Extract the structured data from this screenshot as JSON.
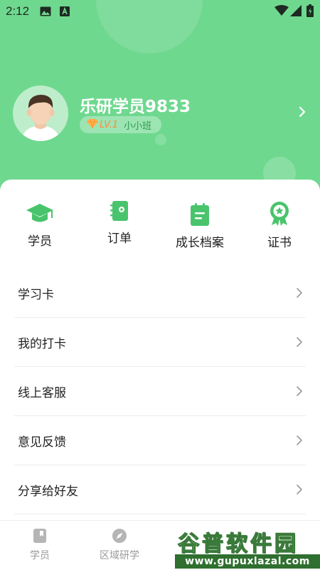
{
  "status_bar": {
    "time": "2:12",
    "icons": [
      "image-icon",
      "a-notification-icon",
      "wifi-icon",
      "signal-icon",
      "battery-icon"
    ]
  },
  "profile": {
    "username": "乐研学员9833",
    "level": "LV.1",
    "class_name": "小小班",
    "icons": [
      "avatar",
      "diamond-icon",
      "chevron-right-icon"
    ]
  },
  "quick_actions": [
    {
      "label": "学员",
      "icon": "graduation-cap-icon"
    },
    {
      "label": "订单",
      "icon": "order-book-icon"
    },
    {
      "label": "成长档案",
      "icon": "growth-file-icon"
    },
    {
      "label": "证书",
      "icon": "certificate-badge-icon"
    }
  ],
  "menu": [
    {
      "label": "学习卡"
    },
    {
      "label": "我的打卡"
    },
    {
      "label": "线上客服"
    },
    {
      "label": "意见反馈"
    },
    {
      "label": "分享给好友"
    }
  ],
  "tabbar": [
    {
      "label": "学员",
      "icon": "book-icon"
    },
    {
      "label": "区域研学",
      "icon": "compass-icon"
    }
  ],
  "watermark": {
    "title": "谷普软件园",
    "url": "www.gupuxlazal.com"
  },
  "colors": {
    "header_green": "#6fd88f",
    "icon_green": "#49c46c",
    "level_orange": "#ff8a3d",
    "text_dark": "#222222",
    "tab_gray": "#9a9a9a"
  }
}
